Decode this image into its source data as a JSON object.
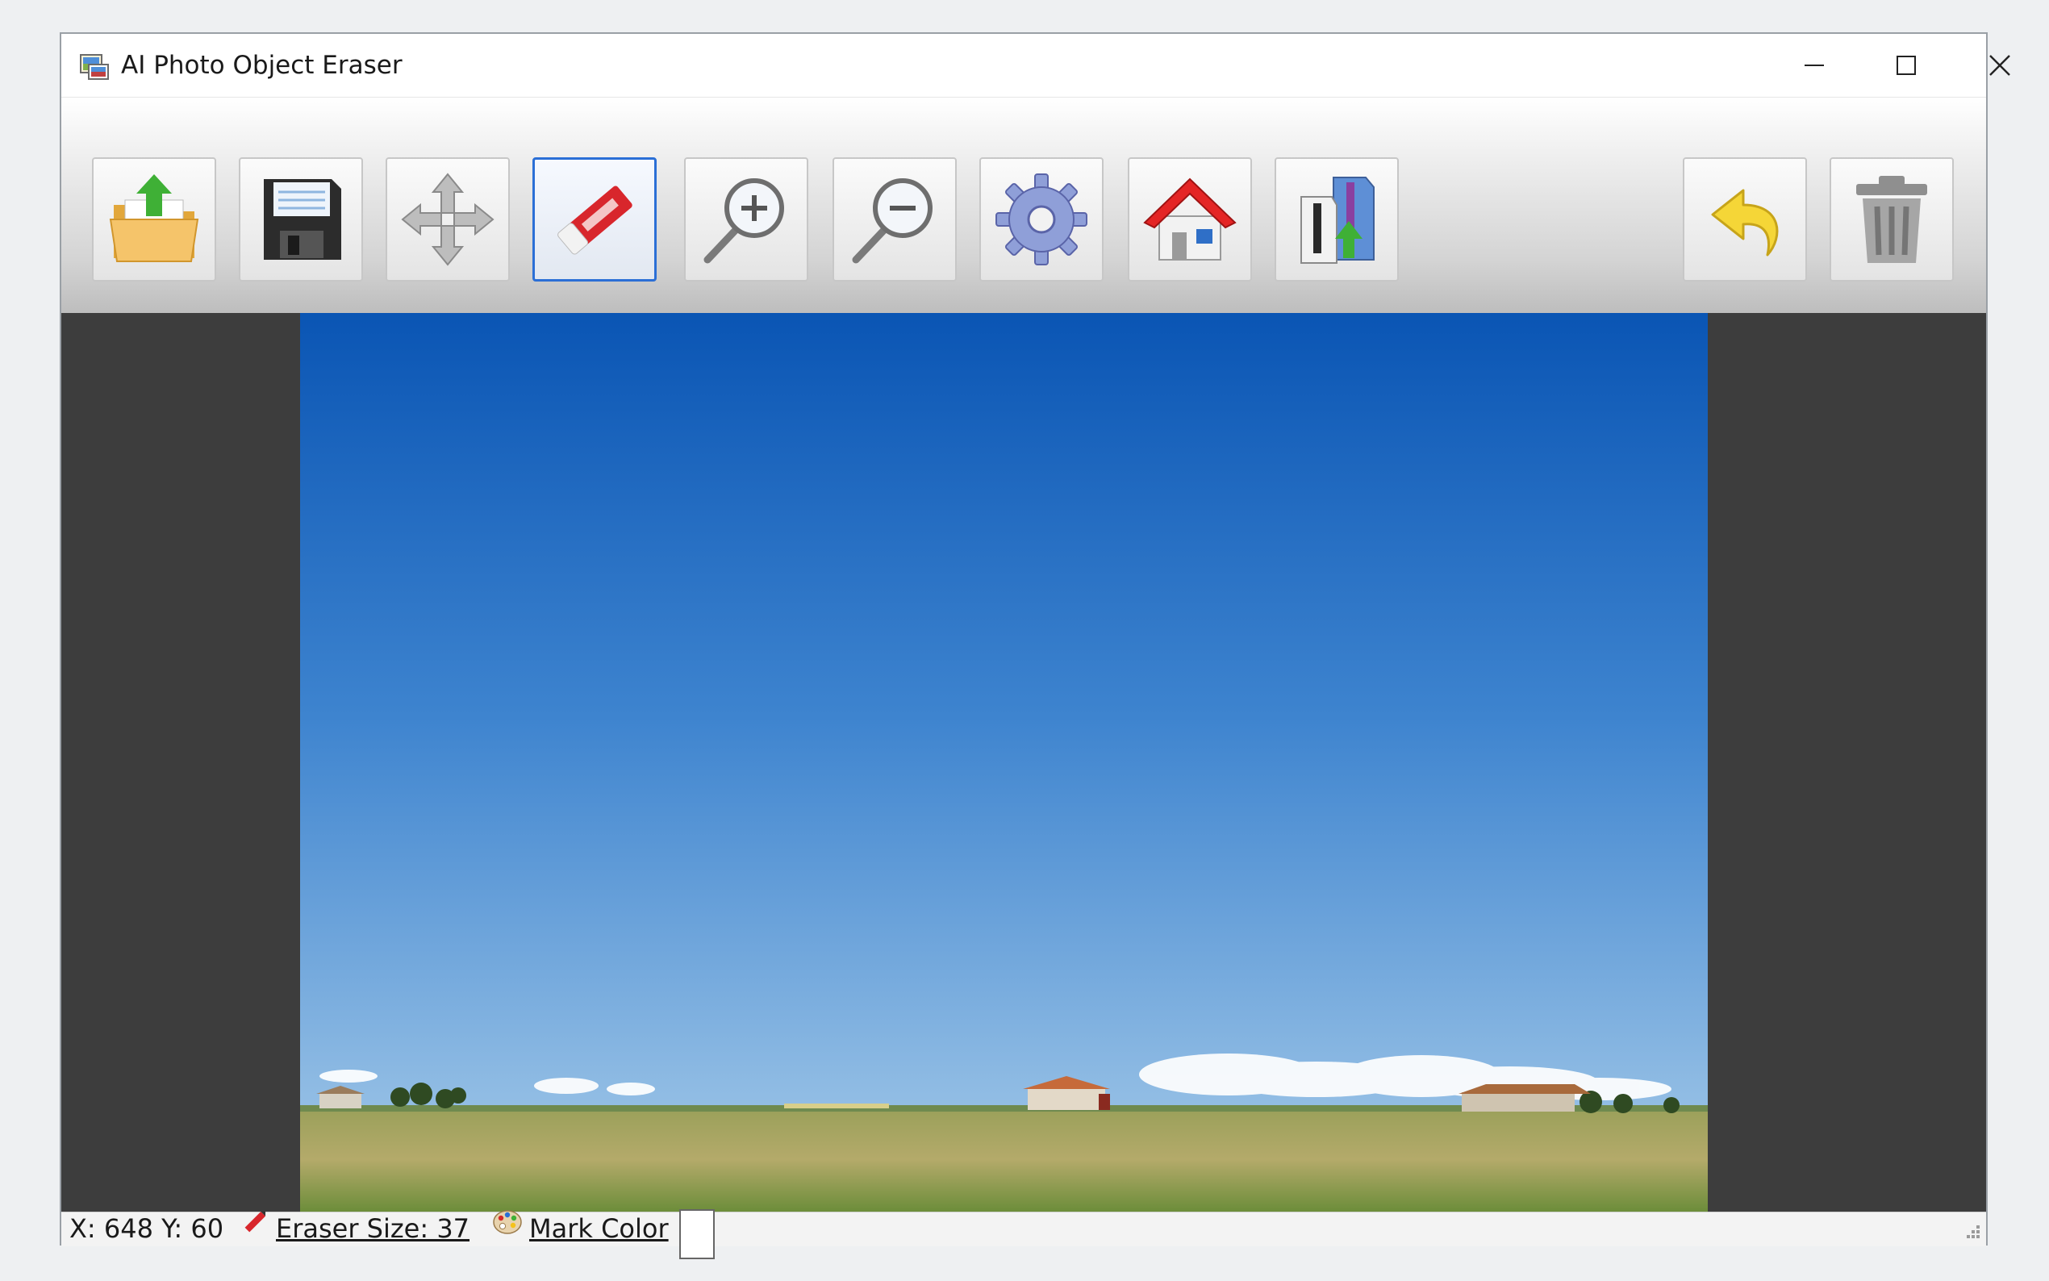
{
  "window": {
    "title": "AI Photo Object Eraser",
    "controls": {
      "minimize": "minimize-icon",
      "maximize": "maximize-icon",
      "close": "close-icon"
    }
  },
  "toolbar": {
    "buttons": [
      {
        "id": "open",
        "icon": "open-folder-icon"
      },
      {
        "id": "save",
        "icon": "floppy-disk-icon"
      },
      {
        "id": "move",
        "icon": "move-arrows-icon"
      },
      {
        "id": "eraser",
        "icon": "eraser-icon",
        "selected": true
      },
      {
        "id": "zoom-in",
        "icon": "zoom-in-icon"
      },
      {
        "id": "zoom-out",
        "icon": "zoom-out-icon"
      },
      {
        "id": "settings",
        "icon": "gear-icon"
      },
      {
        "id": "home",
        "icon": "home-icon"
      },
      {
        "id": "upgrade",
        "icon": "shirts-upload-icon"
      },
      {
        "id": "undo",
        "icon": "undo-arrow-icon"
      },
      {
        "id": "delete",
        "icon": "trash-can-icon"
      }
    ]
  },
  "canvas": {
    "image": "landscape-photo",
    "colors": {
      "background": "#3d3d3d",
      "sky_top": "#0a55b4",
      "sky_bottom": "#a9cdea",
      "field": "#9aa05a"
    }
  },
  "status": {
    "coords": "X: 648 Y: 60",
    "eraser_size": "Eraser Size: 37",
    "mark_color_label": "Mark Color",
    "mark_color_value": "#ffffff"
  },
  "colors": {
    "accent": "#2b6fd6"
  }
}
